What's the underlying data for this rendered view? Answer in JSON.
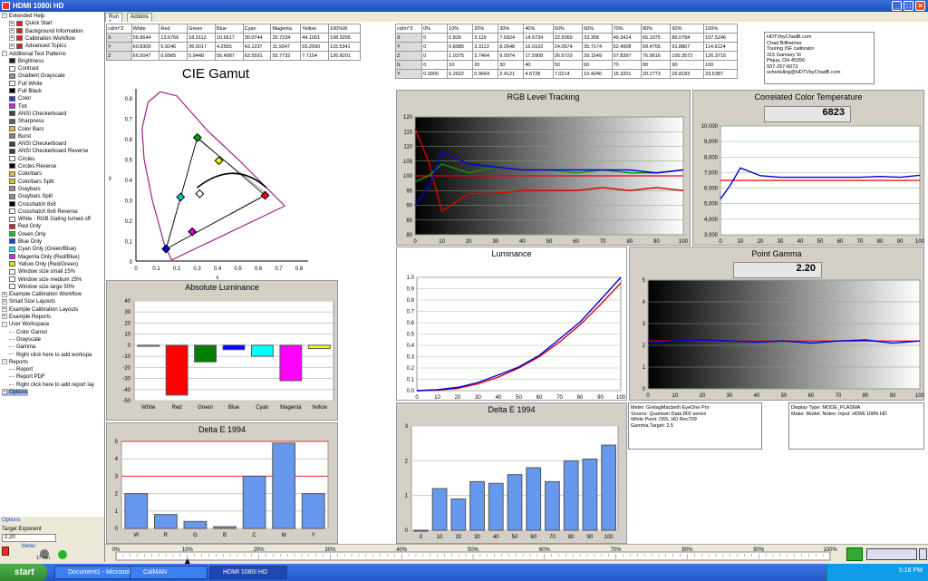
{
  "window": {
    "title": "HDMI 1080i HD"
  },
  "tabs": [
    "Run 1",
    "Actions"
  ],
  "tree": [
    {
      "level": 0,
      "exp": "−",
      "label": "Extended Help"
    },
    {
      "level": 1,
      "exp": "+",
      "label": "Quick Start",
      "color": "#e02020"
    },
    {
      "level": 1,
      "exp": "+",
      "label": "Background Information",
      "color": "#e02020"
    },
    {
      "level": 1,
      "exp": "+",
      "label": "Calibration Workflow",
      "color": "#e02020"
    },
    {
      "level": 1,
      "exp": "+",
      "label": "Advanced Topics",
      "color": "#e02020"
    },
    {
      "level": 0,
      "exp": "−",
      "label": "Additional Test Patterns"
    },
    {
      "level": 1,
      "label": "Brightness",
      "color": "#202020"
    },
    {
      "level": 1,
      "label": "Contrast",
      "color": "#ffffff"
    },
    {
      "level": 1,
      "label": "Gradient Grayscale",
      "color": "#909090"
    },
    {
      "level": 1,
      "label": "Full White",
      "color": "#ffffff"
    },
    {
      "level": 1,
      "label": "Full Black",
      "color": "#000000"
    },
    {
      "level": 1,
      "label": "Color",
      "color": "#2040e0"
    },
    {
      "level": 1,
      "label": "Tint",
      "color": "#d020d0"
    },
    {
      "level": 1,
      "label": "ANSI Checkerboard",
      "color": "#404040"
    },
    {
      "level": 1,
      "label": "Sharpness",
      "color": "#606060"
    },
    {
      "level": 1,
      "label": "Color Bars",
      "color": "#e0c020"
    },
    {
      "level": 1,
      "label": "Burst",
      "color": "#808080"
    },
    {
      "level": 1,
      "label": "ANSI Checkerboard",
      "color": "#404040"
    },
    {
      "level": 1,
      "label": "ANSI Checkerboard Reverse",
      "color": "#404040"
    },
    {
      "level": 1,
      "label": "Circles",
      "color": "#ffffff"
    },
    {
      "level": 1,
      "label": "Circles Reverse",
      "color": "#000000"
    },
    {
      "level": 1,
      "label": "Colorbars",
      "color": "#e0c020"
    },
    {
      "level": 1,
      "label": "Colorbars Split",
      "color": "#e0c020"
    },
    {
      "level": 1,
      "label": "Graybars",
      "color": "#909090"
    },
    {
      "level": 1,
      "label": "Graybars Split",
      "color": "#909090"
    },
    {
      "level": 1,
      "label": "Crosshatch 8x8",
      "color": "#000000"
    },
    {
      "level": 1,
      "label": "Crosshatch 8x8 Reverse",
      "color": "#ffffff"
    },
    {
      "level": 1,
      "label": "White - RGB Gating turned off",
      "color": "#ffffff"
    },
    {
      "level": 1,
      "label": "Red Only",
      "color": "#e02020"
    },
    {
      "level": 1,
      "label": "Green Only",
      "color": "#20c020"
    },
    {
      "level": 1,
      "label": "Blue Only",
      "color": "#2040e0"
    },
    {
      "level": 1,
      "label": "Cyan Only (Green/Blue)",
      "color": "#20e0e0"
    },
    {
      "level": 1,
      "label": "Magenta Only (Red/Blue)",
      "color": "#e020e0"
    },
    {
      "level": 1,
      "label": "Yellow Only (Red/Green)",
      "color": "#e0e020"
    },
    {
      "level": 1,
      "label": "Window size small 15%",
      "color": "#ffffff"
    },
    {
      "level": 1,
      "label": "Window size medium 25%",
      "color": "#ffffff"
    },
    {
      "level": 1,
      "label": "Window size large 50%",
      "color": "#ffffff"
    },
    {
      "level": 0,
      "exp": "+",
      "label": "Example Calibration Workflow"
    },
    {
      "level": 0,
      "exp": "+",
      "label": "Small Size Layouts"
    },
    {
      "level": 0,
      "exp": "+",
      "label": "Example Calibration Layouts"
    },
    {
      "level": 0,
      "exp": "+",
      "label": "Example Reports"
    },
    {
      "level": 0,
      "exp": "−",
      "label": "User Workspace"
    },
    {
      "level": 1,
      "label": "Color Gamut"
    },
    {
      "level": 1,
      "label": "Grayscale"
    },
    {
      "level": 1,
      "label": "Gamma"
    },
    {
      "level": 1,
      "label": "Right click here to add workspa"
    },
    {
      "level": 0,
      "exp": "−",
      "label": "Reports"
    },
    {
      "level": 1,
      "label": "Report"
    },
    {
      "level": 1,
      "label": "Report PDF"
    },
    {
      "level": 1,
      "label": "Right click here to add report lay"
    },
    {
      "level": 0,
      "exp": "+",
      "label": "Options",
      "selected": true
    }
  ],
  "options_panel": {
    "header": "Options",
    "field_label": "Target Exponent",
    "field_value": "2.20",
    "meter_label": "Meter",
    "meter_sub": "17 min"
  },
  "color_table": {
    "headers": [
      "cd/m^2",
      "White",
      "Red",
      "Green",
      "Blue",
      "Cyan",
      "Magenta",
      "Yellow",
      "100%W"
    ],
    "rows": [
      [
        "X",
        "56.8644",
        "13.6766",
        "18.0112",
        "10.6617",
        "30.0744",
        "25.7234",
        "44.1061",
        "108.0255"
      ],
      [
        "Y",
        "60.8305",
        "6.9246",
        "36.6017",
        "4.2555",
        "43.1237",
        "11.9347",
        "55.2590",
        "115.5341"
      ],
      [
        "Z",
        "66.5047",
        "0.6965",
        "5.9448",
        "56.4987",
        "63.5591",
        "55.7732",
        "7.7154",
        "126.8201"
      ]
    ]
  },
  "gray_table": {
    "headers": [
      "cd/m^2",
      "0%",
      "10%",
      "20%",
      "30%",
      "40%",
      "50%",
      "60%",
      "70%",
      "80%",
      "90%",
      "100%"
    ],
    "rows": [
      [
        "X",
        "0",
        "0.826",
        "3.119",
        "7.6924",
        "14.9734",
        "22.5069",
        "33.358",
        "49.3414",
        "65.1075",
        "86.0784",
        "107.5246"
      ],
      [
        "Y",
        "0",
        "0.8985",
        "3.3113",
        "8.2648",
        "16.0103",
        "24.0574",
        "35.7174",
        "52.4908",
        "69.4755",
        "91.8867",
        "114.9124"
      ],
      [
        "Z",
        "0",
        "1.0375",
        "3.7464",
        "9.0974",
        "17.5908",
        "26.5729",
        "39.1549",
        "57.8397",
        "76.9616",
        "100.3572",
        "126.3715"
      ]
    ],
    "ire": [
      "IL",
      "0",
      "10",
      "20",
      "30",
      "40",
      "50",
      "60",
      "70",
      "80",
      "90",
      "100"
    ],
    "yrow": [
      "Y",
      "0.0000",
      "0.2622",
      "0.9664",
      "2.4121",
      "4.6728",
      "7.0214",
      "10.4246",
      "15.3201",
      "20.2773",
      "26.8183",
      "33.5387"
    ]
  },
  "contact": [
    "HDTVbyChadB.com",
    "Chad Billheimer",
    "Touring ISF calibrator",
    "315 Gamsey St",
    "Piqua, OH 45356",
    "937-267-6073",
    "scheduling@HDTVbyChadB.com"
  ],
  "meter_info": [
    "Meter: GretagMacbeth EyeOne Pro",
    "Source: Quantum Data 802 series",
    "White Point: D65, HD Rec709",
    "Gamma Target: 2.5"
  ],
  "display_info": [
    "Display Type: MODE_PLASMA",
    "Make: Model: Notes: Input: HDMI 1080i HD"
  ],
  "charts": {
    "cie": {
      "type": "scatter",
      "title": "CIE Gamut",
      "xlabel": "x",
      "ylabel": "y",
      "xlim": [
        0,
        0.8
      ],
      "ylim": [
        0,
        0.8
      ],
      "target": [
        {
          "name": "R",
          "x": 0.64,
          "y": 0.33
        },
        {
          "name": "G",
          "x": 0.3,
          "y": 0.6
        },
        {
          "name": "B",
          "x": 0.15,
          "y": 0.06
        }
      ],
      "measured": [
        {
          "name": "R",
          "x": 0.6335,
          "y": 0.322
        },
        {
          "name": "G",
          "x": 0.3014,
          "y": 0.6055
        },
        {
          "name": "B",
          "x": 0.1474,
          "y": 0.0594
        },
        {
          "name": "C",
          "x": 0.2189,
          "y": 0.3138
        },
        {
          "name": "M",
          "x": 0.2762,
          "y": 0.1437
        },
        {
          "name": "Y",
          "x": 0.4069,
          "y": 0.4924
        },
        {
          "name": "W",
          "x": 0.3125,
          "y": 0.3298
        }
      ]
    },
    "abs_lum": {
      "type": "bar",
      "title": "Absolute Luminance",
      "categories": [
        "White",
        "Red",
        "Green",
        "Blue",
        "Cyan",
        "Magenta",
        "Yellow"
      ],
      "values": [
        -1,
        -45,
        -15,
        -4,
        -10,
        -32,
        -3
      ],
      "colors": [
        "#ffffff",
        "#ff0000",
        "#008000",
        "#0000ff",
        "#00ffff",
        "#ff00ff",
        "#ffff00"
      ],
      "ylim": [
        -50,
        40
      ],
      "yticks": [
        40,
        30,
        20,
        10,
        0,
        -10,
        -20,
        -30,
        -40,
        -50
      ]
    },
    "de_color": {
      "type": "bar",
      "title": "Delta E 1994",
      "categories": [
        "W",
        "R",
        "G",
        "B",
        "C",
        "M",
        "Y"
      ],
      "values": [
        2.0,
        0.8,
        0.4,
        0.1,
        3.0,
        4.9,
        2.0
      ],
      "ylim": [
        0,
        5
      ],
      "yticks": [
        0,
        1,
        2,
        3,
        4,
        5
      ],
      "ref_lines": [
        3,
        5
      ]
    },
    "rgb": {
      "type": "line",
      "title": "RGB Level Tracking",
      "x": [
        0,
        5,
        10,
        20,
        30,
        40,
        50,
        60,
        70,
        80,
        90,
        100
      ],
      "ylim": [
        80,
        120
      ],
      "yticks": [
        80,
        85,
        90,
        95,
        100,
        105,
        110,
        115,
        120
      ],
      "series": [
        {
          "color": "#e00000",
          "values": [
            116,
            105,
            88,
            94,
            94,
            95,
            95,
            95,
            96,
            95,
            96,
            95
          ]
        },
        {
          "color": "#00a000",
          "values": [
            98,
            100,
            104,
            101,
            103,
            102,
            102,
            101,
            102,
            101,
            101,
            102
          ]
        },
        {
          "color": "#0000e0",
          "values": [
            90,
            96,
            108,
            104,
            103,
            102,
            102,
            102,
            102,
            102,
            101,
            102
          ]
        }
      ],
      "target": 100
    },
    "cct": {
      "type": "line",
      "title": "Correlated Color Temperature",
      "value": "6823",
      "x": [
        0,
        5,
        10,
        20,
        30,
        40,
        50,
        60,
        70,
        80,
        90,
        100
      ],
      "ylim": [
        3000,
        10000
      ],
      "yticks": [
        3000,
        4000,
        5000,
        6000,
        7000,
        8000,
        9000,
        10000
      ],
      "series": [
        {
          "color": "#0000e0",
          "values": [
            5300,
            6200,
            7300,
            6800,
            6700,
            6700,
            6700,
            6700,
            6700,
            6750,
            6700,
            6823
          ]
        }
      ],
      "target": 6500
    },
    "luminance": {
      "type": "line",
      "title": "Luminance",
      "x": [
        0,
        10,
        20,
        30,
        40,
        50,
        60,
        70,
        80,
        90,
        100
      ],
      "ylim": [
        0,
        1
      ],
      "yticks": [
        0,
        0.1,
        0.2,
        0.3,
        0.4,
        0.5,
        0.6,
        0.7,
        0.8,
        0.9,
        1.0
      ],
      "series": [
        {
          "color": "#e00000",
          "values": [
            0,
            0.005,
            0.02,
            0.06,
            0.12,
            0.2,
            0.3,
            0.43,
            0.58,
            0.76,
            0.95
          ]
        },
        {
          "color": "#0000e0",
          "values": [
            0,
            0.008,
            0.029,
            0.072,
            0.139,
            0.209,
            0.311,
            0.457,
            0.605,
            0.8,
            1.0
          ]
        }
      ]
    },
    "gamma": {
      "type": "line",
      "title": "Point Gamma",
      "value": "2.20",
      "x": [
        0,
        10,
        20,
        30,
        40,
        50,
        60,
        70,
        80,
        90,
        100
      ],
      "ylim": [
        0,
        5
      ],
      "yticks": [
        0,
        1,
        2,
        3,
        4,
        5
      ],
      "series": [
        {
          "color": "#0000e0",
          "values": [
            2.1,
            2.2,
            2.25,
            2.2,
            2.15,
            2.2,
            2.1,
            2.2,
            2.25,
            2.1,
            2.2
          ]
        }
      ],
      "target": 2.2
    },
    "de_gray": {
      "type": "bar",
      "title": "Delta E 1994",
      "categories": [
        "0",
        "10",
        "20",
        "30",
        "40",
        "50",
        "60",
        "70",
        "80",
        "90",
        "100"
      ],
      "values": [
        0,
        1.2,
        0.9,
        1.4,
        1.35,
        1.6,
        1.8,
        1.4,
        2.0,
        2.05,
        2.45
      ],
      "ylim": [
        0,
        3
      ],
      "yticks": [
        0,
        1,
        2,
        3
      ]
    }
  },
  "timeline": {
    "ticks": [
      "0%",
      "10%",
      "20%",
      "30%",
      "40%",
      "50%",
      "60%",
      "70%",
      "80%",
      "90%",
      "100%"
    ],
    "position": 0.1
  },
  "taskbar": {
    "start": "start",
    "items": [
      "Document1 - Microsof...",
      "CalMAN",
      "HDMI 1080i HD"
    ],
    "clock": "5:16 PM"
  }
}
